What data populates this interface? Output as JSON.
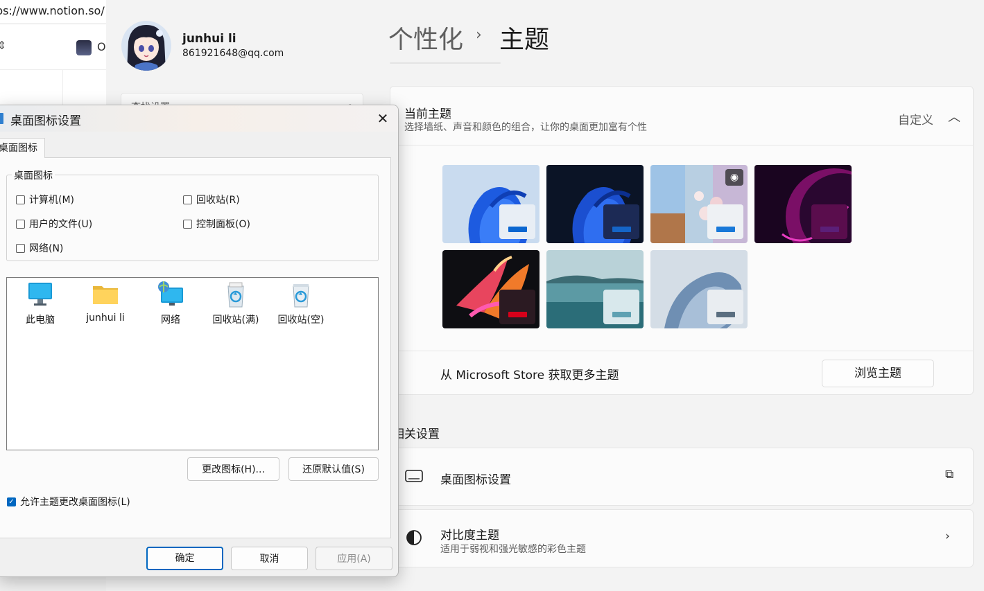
{
  "browser": {
    "url": "ps://www.notion.so/",
    "tab_initial": "O"
  },
  "settings": {
    "user": {
      "name": "junhui li",
      "email": "861921648@qq.com"
    },
    "search_placeholder": "查找设置",
    "breadcrumb": {
      "parent": "个性化",
      "separator": "›",
      "current": "主题"
    },
    "theme_card": {
      "title": "当前主题",
      "description": "选择墙纸、声音和颜色的组合，让你的桌面更加富有个性",
      "value": "自定义",
      "store_text": "从 Microsoft Store 获取更多主题",
      "store_button": "浏览主题",
      "themes": [
        {
          "name": "windows-light",
          "tile": "#e8eef5",
          "bar": "#0a66d0"
        },
        {
          "name": "windows-dark",
          "tile": "#1c2a55",
          "bar": "#1565c8"
        },
        {
          "name": "spotlight",
          "tile": "#eef1f4",
          "bar": "#1878d8"
        },
        {
          "name": "glow",
          "tile": "#5a0d4d",
          "bar": "#5b1f78"
        },
        {
          "name": "captured-motion",
          "tile": "#2b1a22",
          "bar": "#d7001a"
        },
        {
          "name": "sunrise",
          "tile": "#d8e8ec",
          "bar": "#5ea1b2"
        },
        {
          "name": "flow",
          "tile": "#e9edf1",
          "bar": "#5a6e80"
        }
      ]
    },
    "related": {
      "heading": "相关设置",
      "desktop_icons": "桌面图标设置",
      "contrast_title": "对比度主题",
      "contrast_sub": "适用于弱视和强光敏感的彩色主题"
    }
  },
  "dialog": {
    "title": "桌面图标设置",
    "tab": "桌面图标",
    "group_label": "桌面图标",
    "checkboxes": [
      {
        "label": "计算机(M)",
        "checked": false
      },
      {
        "label": "回收站(R)",
        "checked": false
      },
      {
        "label": "用户的文件(U)",
        "checked": false
      },
      {
        "label": "控制面板(O)",
        "checked": false
      },
      {
        "label": "网络(N)",
        "checked": false
      }
    ],
    "icons": [
      {
        "label": "此电脑",
        "icon": "monitor-icon"
      },
      {
        "label": "junhui li",
        "icon": "folder-icon"
      },
      {
        "label": "网络",
        "icon": "network-icon"
      },
      {
        "label": "回收站(满)",
        "icon": "recycle-bin-full-icon"
      },
      {
        "label": "回收站(空)",
        "icon": "recycle-bin-empty-icon"
      }
    ],
    "change_icon": "更改图标(H)...",
    "restore_default": "还原默认值(S)",
    "allow_themes": "允许主题更改桌面图标(L)",
    "allow_themes_checked": true,
    "ok": "确定",
    "cancel": "取消",
    "apply": "应用(A)"
  }
}
